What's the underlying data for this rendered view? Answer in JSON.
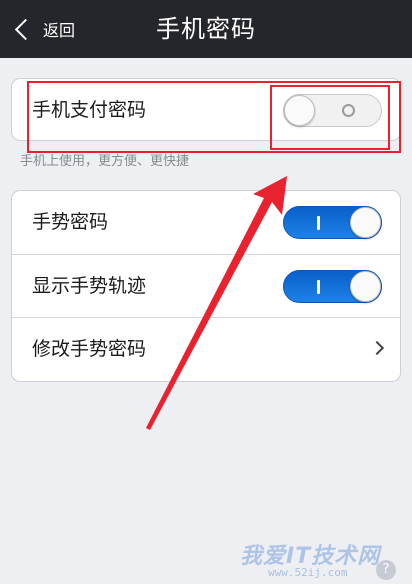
{
  "header": {
    "back_label": "返回",
    "title": "手机密码"
  },
  "payment": {
    "label": "手机支付密码",
    "enabled": false,
    "hint": "手机上使用，更方便、更快捷"
  },
  "gesture": {
    "rows": [
      {
        "label": "手势密码",
        "type": "switch",
        "enabled": true
      },
      {
        "label": "显示手势轨迹",
        "type": "switch",
        "enabled": true
      },
      {
        "label": "修改手势密码",
        "type": "link"
      }
    ]
  },
  "colors": {
    "navbar": "#25262b",
    "switch_on": "#1c83e8",
    "annotation": "#e8222e"
  },
  "watermark": {
    "text": "我爱IT技术网",
    "url": "www.52ij.com"
  },
  "icons": {
    "back": "chevron-left-icon",
    "disclosure": "chevron-right-icon",
    "help": "help-icon"
  }
}
